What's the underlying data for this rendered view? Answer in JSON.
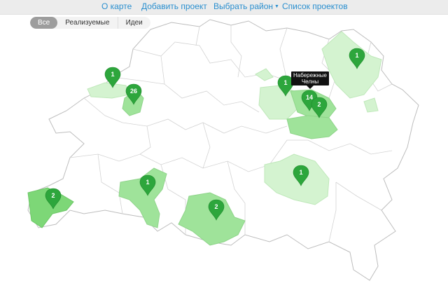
{
  "nav": {
    "about": "О карте",
    "add_project": "Добавить проект",
    "choose_district": "Выбрать район",
    "project_list": "Список проектов"
  },
  "filters": {
    "all": "Все",
    "implemented": "Реализуемые",
    "ideas": "Идеи",
    "active": "all"
  },
  "colors": {
    "pin": "#2da63c",
    "district_light": "#d4f3d0",
    "district_mid": "#9fe39a",
    "district_strong": "#7dd777",
    "nav_link": "#2a8fcf"
  },
  "markers": [
    {
      "id": "nw-1",
      "count": "1"
    },
    {
      "id": "kazan",
      "count": "26"
    },
    {
      "id": "west-1",
      "count": "1"
    },
    {
      "id": "southwest-2",
      "count": "2"
    },
    {
      "id": "south-2",
      "count": "2"
    },
    {
      "id": "center-east-1",
      "count": "1"
    },
    {
      "id": "northeast-1",
      "count": "1"
    },
    {
      "id": "chelny",
      "count": "14"
    },
    {
      "id": "chelny-area-2",
      "count": "2"
    },
    {
      "id": "far-ne-1",
      "count": "1"
    }
  ],
  "tooltip": {
    "line1": "Набережные",
    "line2": "Челны"
  }
}
